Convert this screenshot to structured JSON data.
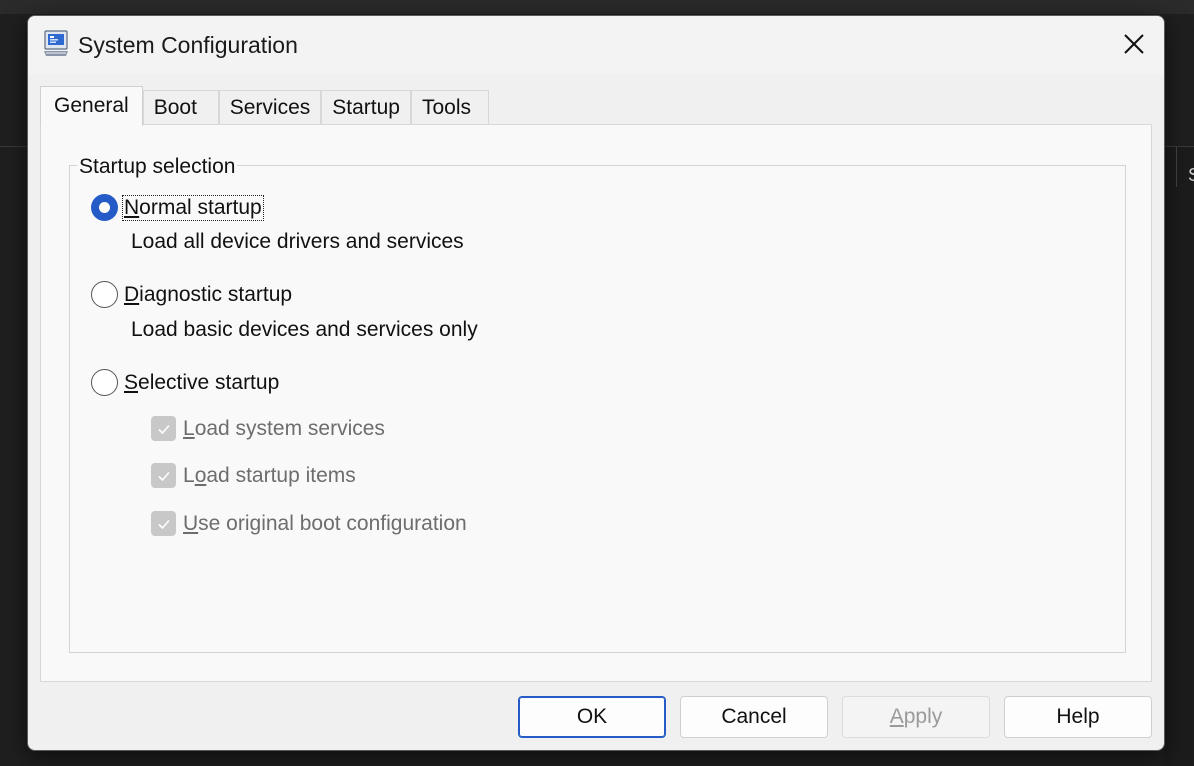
{
  "window": {
    "title": "System Configuration",
    "icon": "msconfig-computer-icon",
    "close_icon": "close-icon"
  },
  "tabs": [
    {
      "label": "General",
      "active": true
    },
    {
      "label": "Boot",
      "active": false
    },
    {
      "label": "Services",
      "active": false
    },
    {
      "label": "Startup",
      "active": false
    },
    {
      "label": "Tools",
      "active": false
    }
  ],
  "startup_selection": {
    "group_label": "Startup selection",
    "selected": "normal",
    "options": {
      "normal": {
        "label_first": "N",
        "label_rest": "ormal startup",
        "description": "Load all device drivers and services"
      },
      "diagnostic": {
        "label_first": "D",
        "label_rest": "iagnostic startup",
        "description": "Load basic devices and services only"
      },
      "selective": {
        "label_first": "S",
        "label_rest": "elective startup"
      }
    },
    "selective_items": {
      "system_services": {
        "label_first": "L",
        "label_rest": "oad system services",
        "checked": true,
        "enabled": false
      },
      "startup_items": {
        "label_pre": "L",
        "label_key": "o",
        "label_rest": "ad startup items",
        "checked": true,
        "enabled": false
      },
      "boot_config": {
        "label_first": "U",
        "label_rest": "se original boot configuration",
        "checked": true,
        "enabled": false
      }
    }
  },
  "buttons": {
    "ok": "OK",
    "cancel": "Cancel",
    "apply_first": "A",
    "apply_rest": "pply",
    "help": "Help"
  },
  "background": {
    "partial_glyph": "S"
  },
  "colors": {
    "accent": "#245bc6",
    "dialog_bg": "#f0f0f0",
    "panel_bg": "#f9f9f9",
    "disabled_text": "#6d6d6d"
  }
}
